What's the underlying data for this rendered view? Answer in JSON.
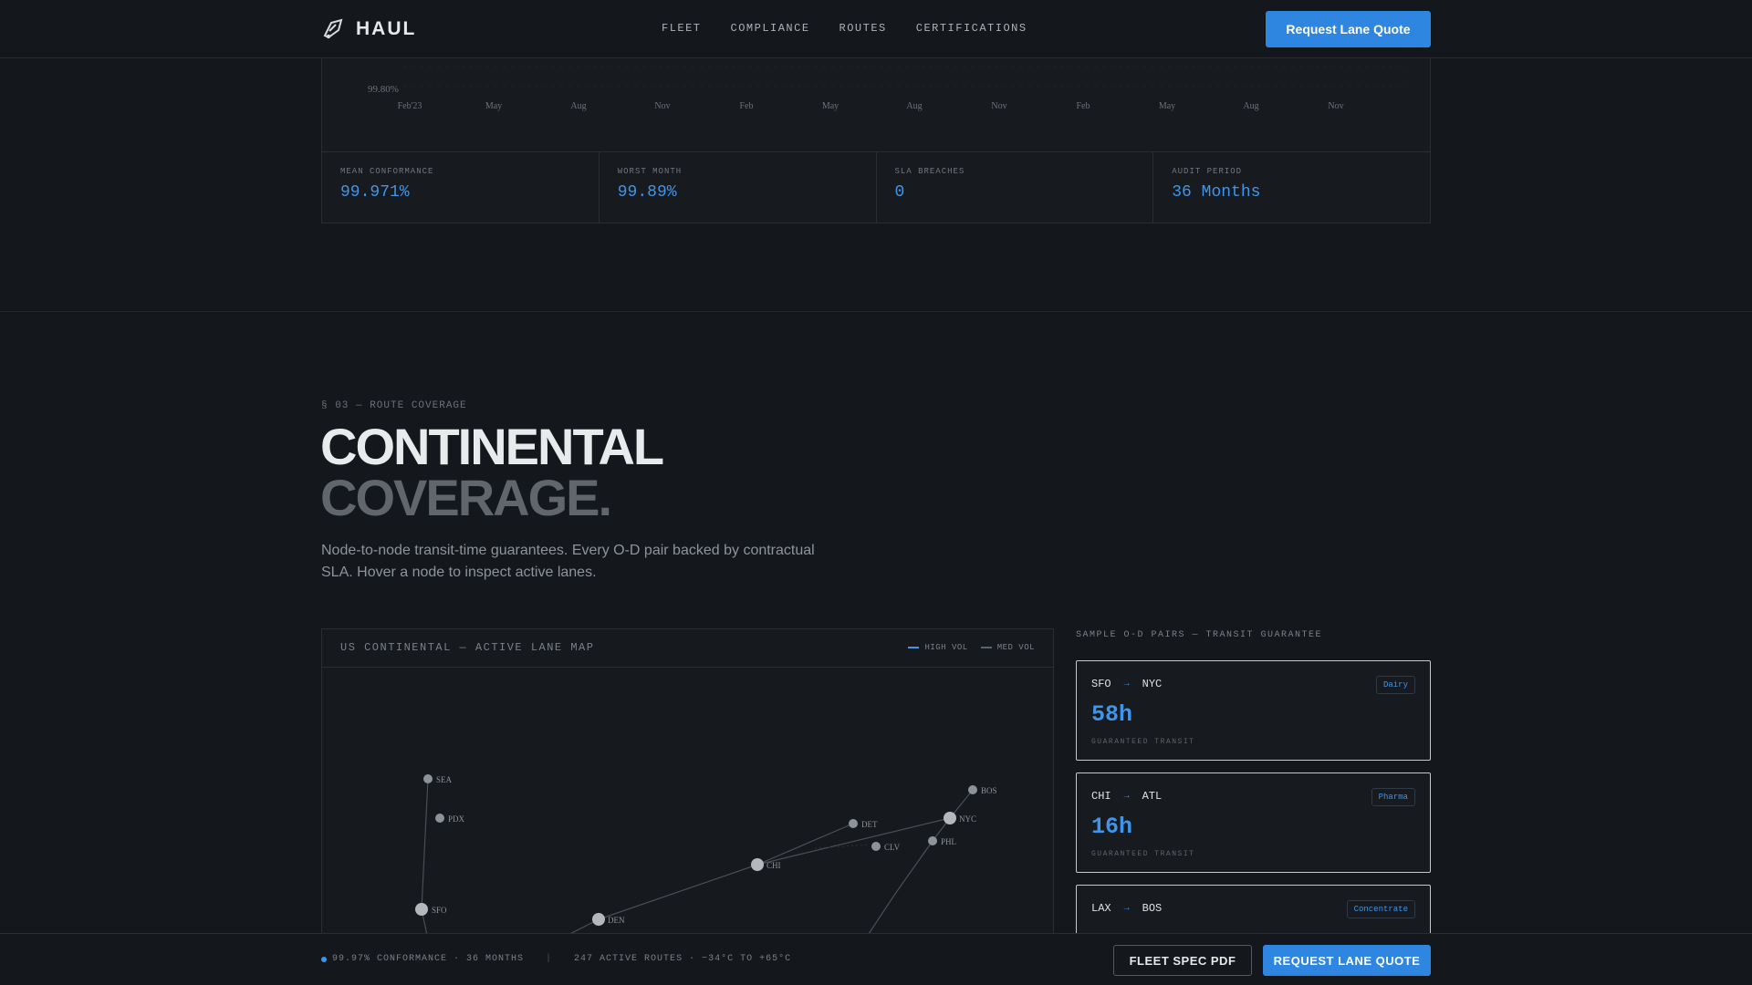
{
  "nav": {
    "brand": "HAUL",
    "brand_icon": "truck-arrow-icon",
    "links": [
      "FLEET",
      "COMPLIANCE",
      "ROUTES",
      "CERTIFICATIONS"
    ],
    "cta": "Request Lane Quote"
  },
  "conformance": {
    "y_tick": "99.80%",
    "months": [
      "Feb'23",
      "May",
      "Aug",
      "Nov",
      "Feb",
      "May",
      "Aug",
      "Nov",
      "Feb",
      "May",
      "Aug",
      "Nov"
    ],
    "stats": [
      {
        "label": "MEAN CONFORMANCE",
        "value": "99.971%"
      },
      {
        "label": "WORST MONTH",
        "value": "99.89%"
      },
      {
        "label": "SLA BREACHES",
        "value": "0"
      },
      {
        "label": "AUDIT PERIOD",
        "value": "36 Months"
      }
    ]
  },
  "section": {
    "eyebrow": "§ 03 — ROUTE COVERAGE",
    "title_line1": "CONTINENTAL",
    "title_line2": "COVERAGE.",
    "lead": "Node-to-node transit-time guarantees. Every O-D pair backed by contractual SLA. Hover a node to inspect active lanes."
  },
  "map": {
    "title": "US CONTINENTAL — ACTIVE LANE MAP",
    "legend": [
      {
        "label": "HIGH VOL",
        "color": "#3f95ea"
      },
      {
        "label": "MED VOL",
        "color": "#5d636a"
      }
    ],
    "nodes": [
      {
        "id": "SEA",
        "major": false
      },
      {
        "id": "PDX",
        "major": false
      },
      {
        "id": "SFO",
        "major": true
      },
      {
        "id": "DEN",
        "major": true
      },
      {
        "id": "CHI",
        "major": true
      },
      {
        "id": "DET",
        "major": false
      },
      {
        "id": "CLV",
        "major": false
      },
      {
        "id": "NYC",
        "major": true
      },
      {
        "id": "BOS",
        "major": false
      },
      {
        "id": "PHL",
        "major": false
      }
    ]
  },
  "pairs": {
    "label": "SAMPLE O-D PAIRS — TRANSIT GUARANTEE",
    "items": [
      {
        "from": "SFO",
        "to": "NYC",
        "arrow": "→",
        "tag": "Dairy",
        "hours": "58h",
        "sub": "GUARANTEED TRANSIT"
      },
      {
        "from": "CHI",
        "to": "ATL",
        "arrow": "→",
        "tag": "Pharma",
        "hours": "16h",
        "sub": "GUARANTEED TRANSIT"
      },
      {
        "from": "LAX",
        "to": "BOS",
        "arrow": "→",
        "tag": "Concentrate",
        "hours": "",
        "sub": ""
      }
    ]
  },
  "bottom_bar": {
    "status": "99.97% CONFORMANCE · 36 MONTHS",
    "separator": "|",
    "routes": "247 ACTIVE ROUTES · −34°C TO +65°C",
    "secondary_cta": "FLEET SPEC PDF",
    "primary_cta": "REQUEST LANE QUOTE"
  },
  "colors": {
    "accent": "#2f86e0",
    "accent_text": "#3f95ea",
    "background": "#14171b"
  }
}
